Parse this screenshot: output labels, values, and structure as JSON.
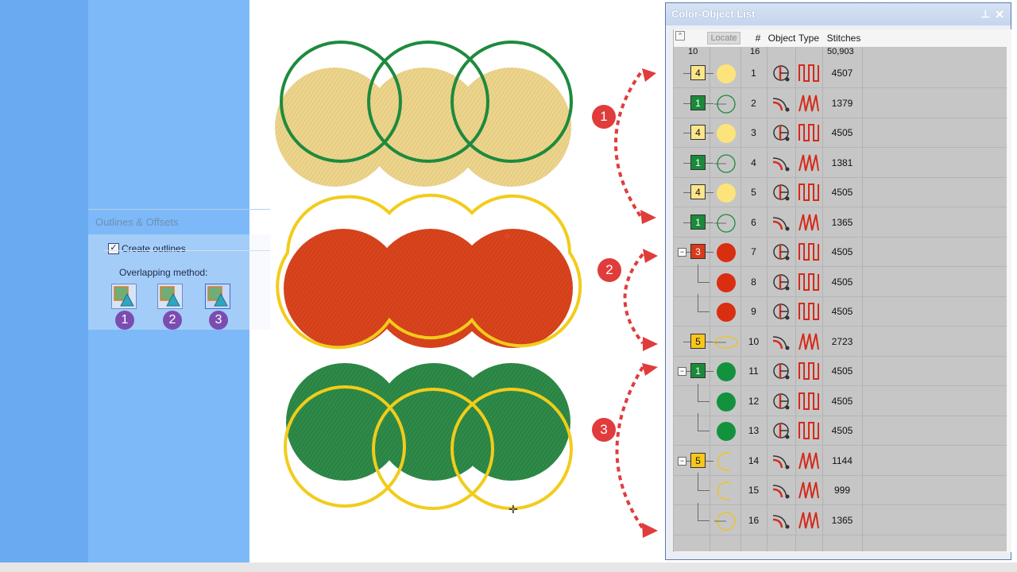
{
  "dialog": {
    "title": "Outlines & Offsets",
    "create_outlines_label": "Create outlines",
    "create_outlines_checked": true,
    "overlapping_label": "Overlapping method:",
    "method_numbers": [
      "1",
      "2",
      "3"
    ]
  },
  "callouts": [
    "1",
    "2",
    "3"
  ],
  "panel": {
    "title": "Color-Object List",
    "locate_label": "Locate",
    "columns": {
      "hash": "#",
      "object": "Object",
      "type": "Type",
      "stitches": "Stitches"
    },
    "summary": {
      "colors": "10",
      "objects": "16",
      "stitches": "50,903"
    },
    "rows": [
      {
        "group": true,
        "expand": false,
        "color_num": "4",
        "swatch": "#fde68a",
        "shape": "filled",
        "shape_color": "#fde47a",
        "num": "1",
        "type": "fill",
        "stitches": "4507"
      },
      {
        "group": true,
        "expand": false,
        "color_num": "1",
        "swatch": "#1a8a3a",
        "shape": "ring",
        "shape_color": "#1a8a3a",
        "num": "2",
        "type": "satin",
        "stitches": "1379"
      },
      {
        "group": true,
        "expand": false,
        "color_num": "4",
        "swatch": "#fde68a",
        "shape": "filled",
        "shape_color": "#fde47a",
        "num": "3",
        "type": "fill",
        "stitches": "4505"
      },
      {
        "group": true,
        "expand": false,
        "color_num": "1",
        "swatch": "#1a8a3a",
        "shape": "ring",
        "shape_color": "#1a8a3a",
        "num": "4",
        "type": "satin",
        "stitches": "1381"
      },
      {
        "group": true,
        "expand": false,
        "color_num": "4",
        "swatch": "#fde68a",
        "shape": "filled",
        "shape_color": "#fde47a",
        "num": "5",
        "type": "fill",
        "stitches": "4505"
      },
      {
        "group": true,
        "expand": false,
        "color_num": "1",
        "swatch": "#1a8a3a",
        "shape": "ring",
        "shape_color": "#1a8a3a",
        "num": "6",
        "type": "satin",
        "stitches": "1365"
      },
      {
        "group": true,
        "expand": true,
        "color_num": "3",
        "swatch": "#d93a1a",
        "shape": "filled",
        "shape_color": "#d92e10",
        "num": "7",
        "type": "fill",
        "stitches": "4505"
      },
      {
        "group": false,
        "expand": false,
        "color_num": "",
        "swatch": "",
        "shape": "filled",
        "shape_color": "#d92e10",
        "num": "8",
        "type": "fill",
        "stitches": "4505"
      },
      {
        "group": false,
        "expand": false,
        "color_num": "",
        "swatch": "",
        "shape": "filled",
        "shape_color": "#d92e10",
        "num": "9",
        "type": "fill",
        "stitches": "4505"
      },
      {
        "group": true,
        "expand": false,
        "color_num": "5",
        "swatch": "#f7c81a",
        "shape": "oval",
        "shape_color": "#f0c414",
        "num": "10",
        "type": "satin",
        "stitches": "2723"
      },
      {
        "group": true,
        "expand": true,
        "color_num": "1",
        "swatch": "#1a8a3a",
        "shape": "filled",
        "shape_color": "#13923e",
        "num": "11",
        "type": "fill",
        "stitches": "4505"
      },
      {
        "group": false,
        "expand": false,
        "color_num": "",
        "swatch": "",
        "shape": "filled",
        "shape_color": "#13923e",
        "num": "12",
        "type": "fill",
        "stitches": "4505"
      },
      {
        "group": false,
        "expand": false,
        "color_num": "",
        "swatch": "",
        "shape": "filled",
        "shape_color": "#13923e",
        "num": "13",
        "type": "fill",
        "stitches": "4505"
      },
      {
        "group": true,
        "expand": true,
        "color_num": "5",
        "swatch": "#f7c81a",
        "shape": "arc",
        "shape_color": "#f0c414",
        "num": "14",
        "type": "satin",
        "stitches": "1144"
      },
      {
        "group": false,
        "expand": false,
        "color_num": "",
        "swatch": "",
        "shape": "arc",
        "shape_color": "#f0c414",
        "num": "15",
        "type": "satin",
        "stitches": "999"
      },
      {
        "group": false,
        "expand": false,
        "color_num": "",
        "swatch": "",
        "shape": "ring",
        "shape_color": "#f0c414",
        "num": "16",
        "type": "satin",
        "stitches": "1365"
      }
    ]
  },
  "colors": {
    "accent_blue": "#7db9f8",
    "callout_red": "#e03c3c",
    "method_purple": "#7b4db1"
  }
}
